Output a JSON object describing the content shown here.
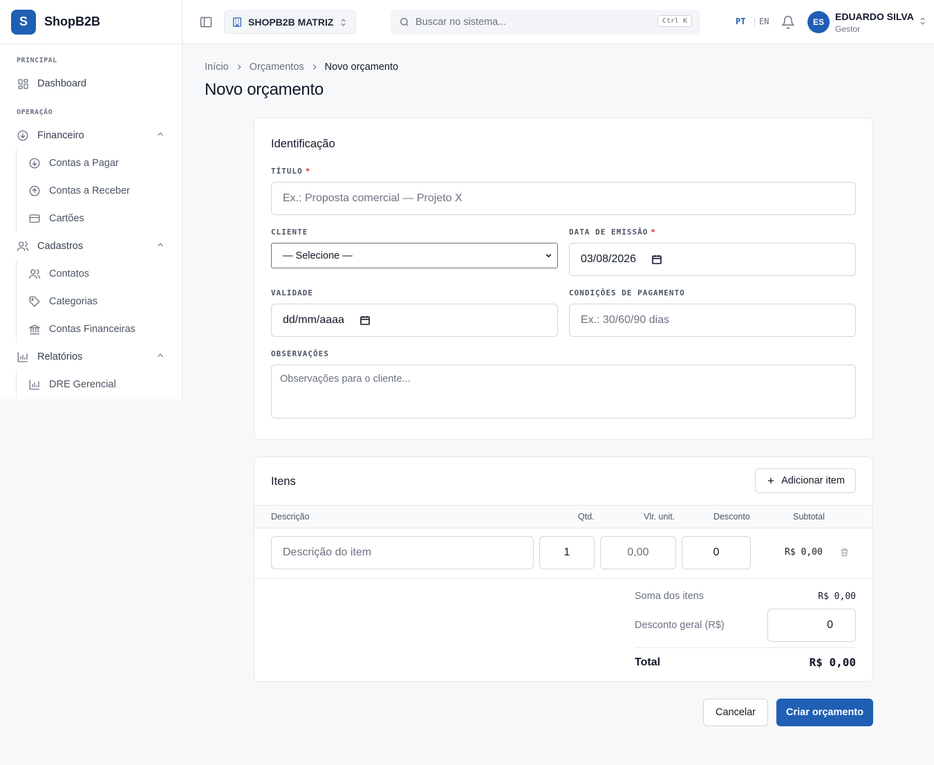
{
  "brand": {
    "logo_letter": "S",
    "name": "ShopB2B"
  },
  "sidebar": {
    "section_principal": "PRINCIPAL",
    "dashboard": "Dashboard",
    "section_operacao": "OPERAÇÃO",
    "financeiro": "Financeiro",
    "contas_pagar": "Contas a Pagar",
    "contas_receber": "Contas a Receber",
    "cartoes": "Cartões",
    "cadastros": "Cadastros",
    "contatos": "Contatos",
    "categorias": "Categorias",
    "contas_financeiras": "Contas Financeiras",
    "relatorios": "Relatórios",
    "dre": "DRE Gerencial"
  },
  "header": {
    "company": "SHOPB2B MATRIZ",
    "search_placeholder": "Buscar no sistema...",
    "shortcut": "Ctrl K",
    "lang_pt": "PT",
    "lang_sep": "|",
    "lang_en": "EN",
    "user_initials": "ES",
    "user_name": "EDUARDO SILVA",
    "user_role": "Gestor"
  },
  "breadcrumb": {
    "home": "Início",
    "section": "Orçamentos",
    "current": "Novo orçamento"
  },
  "page_title": "Novo orçamento",
  "identificacao": {
    "title": "Identificação",
    "titulo_label": "TÍTULO",
    "titulo_placeholder": "Ex.: Proposta comercial — Projeto X",
    "required_mark": "*",
    "cliente_label": "CLIENTE",
    "cliente_value": "— Selecione —",
    "data_label": "DATA DE EMISSÃO",
    "data_value": "03/08/2026",
    "validade_label": "VALIDADE",
    "validade_value": "dd/mm/aaaa",
    "condicoes_label": "CONDIÇÕES DE PAGAMENTO",
    "condicoes_placeholder": "Ex.: 30/60/90 dias",
    "obs_label": "OBSERVAÇÕES",
    "obs_placeholder": "Observações para o cliente..."
  },
  "itens": {
    "title": "Itens",
    "add_button": "Adicionar item",
    "columns": {
      "descricao": "Descrição",
      "qtd": "Qtd.",
      "vlr_unit": "Vlr. unit.",
      "desconto": "Desconto",
      "subtotal": "Subtotal"
    },
    "rows": [
      {
        "descricao_placeholder": "Descrição do item",
        "qtd": "1",
        "vlr_unit": "0,00",
        "desconto": "0",
        "subtotal": "R$ 0,00"
      }
    ],
    "soma_label": "Soma dos itens",
    "soma_value": "R$ 0,00",
    "desconto_geral_label": "Desconto geral (R$)",
    "desconto_geral_value": "0",
    "total_label": "Total",
    "total_value": "R$ 0,00"
  },
  "actions": {
    "cancel": "Cancelar",
    "create": "Criar orçamento"
  },
  "colors": {
    "primary": "#1f5fb4",
    "required": "#dc2626"
  }
}
